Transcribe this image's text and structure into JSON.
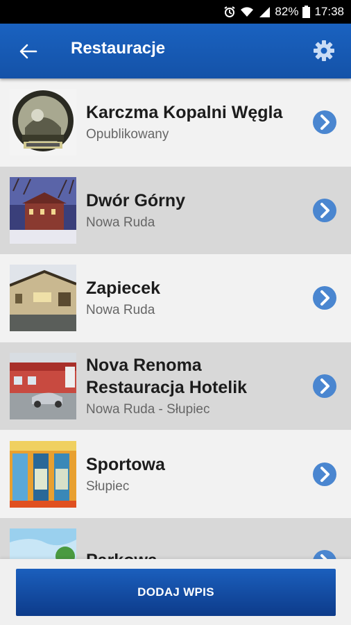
{
  "status_bar": {
    "battery": "82%",
    "time": "17:38"
  },
  "app_bar": {
    "title": "Restauracje",
    "icons": [
      "back-arrow-icon",
      "gear-icon"
    ]
  },
  "items": [
    {
      "name": "Karczma Kopalni Węgla",
      "subtitle": "Opublikowany"
    },
    {
      "name": "Dwór Górny",
      "subtitle": "Nowa Ruda"
    },
    {
      "name": "Zapiecek",
      "subtitle": "Nowa Ruda"
    },
    {
      "name": "Nova Renoma Restauracja Hotelik",
      "subtitle": "Nowa Ruda - Słupiec"
    },
    {
      "name": "Sportowa",
      "subtitle": "Słupiec"
    },
    {
      "name": "Parkowa",
      "subtitle": ""
    }
  ],
  "footer": {
    "add_label": "DODAJ WPIS"
  },
  "colors": {
    "app_bar": "#1a62c0",
    "chevron": "#4a86d0",
    "row_light": "#f2f2f2",
    "row_dark": "#d8d8d8"
  }
}
